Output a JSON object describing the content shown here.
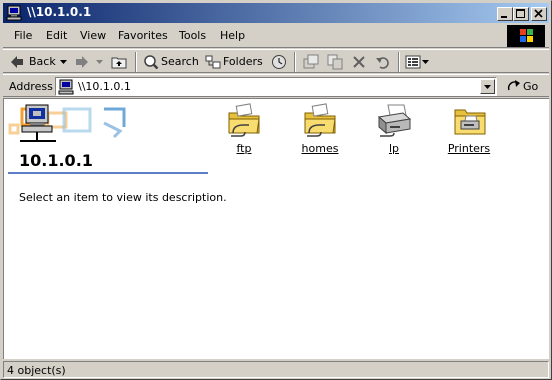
{
  "window": {
    "title": "\\\\10.1.0.1"
  },
  "menubar": {
    "items": [
      "File",
      "Edit",
      "View",
      "Favorites",
      "Tools",
      "Help"
    ]
  },
  "toolbar": {
    "back_label": "Back",
    "search_label": "Search",
    "folders_label": "Folders"
  },
  "address": {
    "label": "Address",
    "value": "\\\\10.1.0.1",
    "go_label": "Go"
  },
  "sidepanel": {
    "title": "10.1.0.1",
    "description": "Select an item to view its description."
  },
  "items": [
    {
      "label": "ftp",
      "icon": "shared-folder-icon"
    },
    {
      "label": "homes",
      "icon": "shared-folder-icon"
    },
    {
      "label": "lp",
      "icon": "printer-icon"
    },
    {
      "label": "Printers",
      "icon": "printers-folder-icon"
    }
  ],
  "statusbar": {
    "text": "4 object(s)"
  },
  "colors": {
    "titlebar_start": "#0a246a",
    "titlebar_end": "#a6caf0",
    "panel_accent": "#5b7ec7",
    "window_face": "#d4d0c8"
  }
}
